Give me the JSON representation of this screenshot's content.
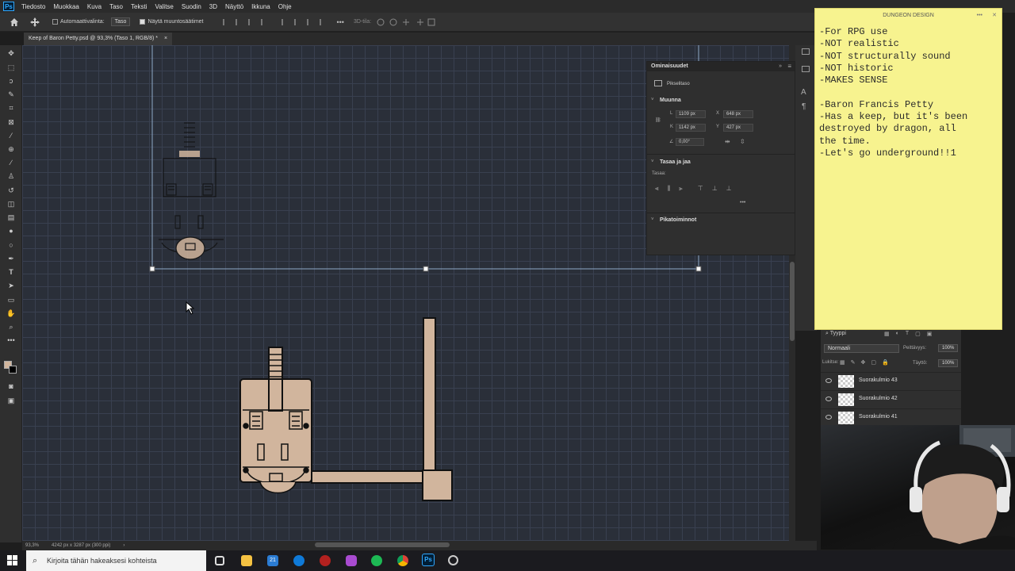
{
  "menubar": {
    "app_glyph": "Ps",
    "items": [
      "Tiedosto",
      "Muokkaa",
      "Kuva",
      "Taso",
      "Teksti",
      "Valitse",
      "Suodin",
      "3D",
      "Näyttö",
      "Ikkuna",
      "Ohje"
    ]
  },
  "options": {
    "auto_select_label": "Automaattivalinta:",
    "auto_select_target": "Taso",
    "show_transform_label": "Näytä muuntosäätimet",
    "mode_3d_label": "3D-tila:"
  },
  "document": {
    "tab_title": "Keep of Baron Petty.psd @ 93,3% (Taso 1, RGB/8) *",
    "close_glyph": "×"
  },
  "status": {
    "zoom": "93,3%",
    "doc_info": "4242 px x 3287 px (300 ppi)",
    "arrow": "›"
  },
  "properties": {
    "title": "Ominaisuudet",
    "type_label": "Pikselitaso",
    "transform_heading": "Muunna",
    "w_label": "L",
    "w_value": "1109 px",
    "h_label": "K",
    "h_value": "1142 px",
    "x_label": "X",
    "x_value": "648 px",
    "y_label": "Y",
    "y_value": "427 px",
    "angle_value": "0,00°",
    "align_heading": "Tasaa ja jaa",
    "align_sub": "Tasaa:",
    "more": "•••",
    "quick_heading": "Pikatoiminnot"
  },
  "layers": {
    "filter_label": "Tyyppi",
    "blend_mode": "Normaali",
    "opacity_label": "Peittävyys:",
    "opacity_value": "100%",
    "lock_label": "Lukitse:",
    "fill_label": "Täyttö:",
    "fill_value": "100%",
    "items": [
      "Suorakulmio 43",
      "Suorakulmio 42",
      "Suorakulmio 41"
    ]
  },
  "sticky": {
    "title": "DUNGEON DESIGN",
    "menu": "•••",
    "close": "✕",
    "text": "-For RPG use\n-NOT realistic\n-NOT structurally sound\n-NOT historic\n-MAKES SENSE\n\n-Baron Francis Petty\n-Has a keep, but it's been\ndestroyed by dragon, all\nthe time.\n-Let's go underground!!1"
  },
  "taskbar": {
    "search_placeholder": "Kirjoita tähän hakeaksesi kohteista",
    "calendar_badge": "21"
  },
  "icons": {
    "home": "home-icon",
    "move": "move-tool-icon",
    "eye": "eye-icon",
    "search": "search-icon"
  },
  "colors": {
    "canvas": "#2a2f39",
    "grid": "#394050",
    "room_fill": "#d1b59d",
    "sticky": "#f7f38f",
    "accent": "#31a8ff"
  }
}
